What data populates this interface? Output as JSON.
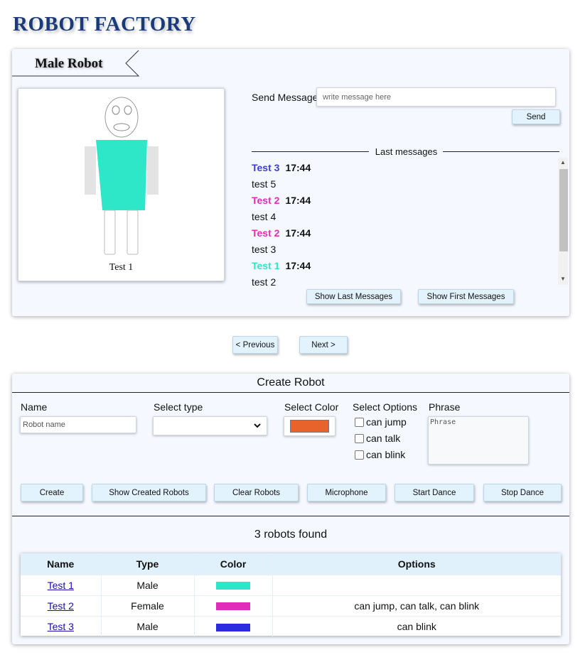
{
  "app": {
    "title": "ROBOT FACTORY"
  },
  "robot_panel": {
    "tab_label": "Male Robot",
    "robot": {
      "name": "Test 1",
      "color": "#2ee6c8"
    },
    "send_label": "Send Message:",
    "message_placeholder": "write message here",
    "send_button": "Send",
    "last_messages_title": "Last messages",
    "messages": [
      {
        "author": "Test 3",
        "time": "17:44",
        "author_color": "#3a3fd1",
        "text": "test 5"
      },
      {
        "author": "Test 2",
        "time": "17:44",
        "author_color": "#e22bb8",
        "text": "test 4"
      },
      {
        "author": "Test 2",
        "time": "17:44",
        "author_color": "#e22bb8",
        "text": "test 3"
      },
      {
        "author": "Test 1",
        "time": "17:44",
        "author_color": "#2ee6c8",
        "text": "test 2"
      }
    ],
    "show_last_button": "Show Last Messages",
    "show_first_button": "Show First Messages"
  },
  "pagination": {
    "previous": "< Previous",
    "next": "Next >"
  },
  "create_panel": {
    "title": "Create Robot",
    "name_label": "Name",
    "name_placeholder": "Robot name",
    "type_label": "Select type",
    "type_value": "",
    "color_label": "Select Color",
    "color_value": "#e8632c",
    "options_label": "Select Options",
    "options": [
      "can jump",
      "can talk",
      "can blink"
    ],
    "phrase_label": "Phrase",
    "phrase_placeholder": "Phrase",
    "buttons": [
      "Create",
      "Show Created Robots",
      "Clear Robots",
      "Microphone",
      "Start Dance",
      "Stop Dance"
    ],
    "found_text": "3 robots found",
    "table": {
      "headers": [
        "Name",
        "Type",
        "Color",
        "Options"
      ],
      "rows": [
        {
          "name": "Test 1",
          "type": "Male",
          "color": "#2ee6c8",
          "options": ""
        },
        {
          "name": "Test 2",
          "type": "Female",
          "color": "#e22bb8",
          "options": "can jump, can talk, can blink"
        },
        {
          "name": "Test 3",
          "type": "Male",
          "color": "#2b2bdf",
          "options": "can blink"
        }
      ]
    }
  }
}
